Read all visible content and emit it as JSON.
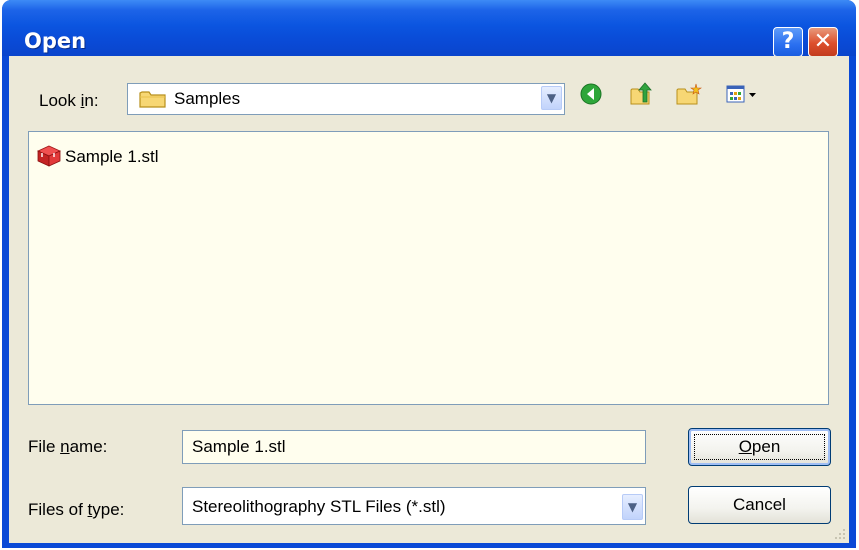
{
  "window": {
    "title": "Open"
  },
  "titlebar": {
    "help_label": "?",
    "close_label": "✕"
  },
  "look_in": {
    "label_pre": "Look ",
    "label_accel": "i",
    "label_post": "n:",
    "value": "Samples"
  },
  "toolbar": {
    "icons": [
      "back-icon",
      "up-folder-icon",
      "new-folder-icon",
      "view-menu-icon"
    ]
  },
  "files": [
    {
      "name": "Sample 1.stl",
      "icon": "stl-file-icon"
    }
  ],
  "file_name": {
    "label_pre": "File ",
    "label_accel": "n",
    "label_post": "ame:",
    "value": "Sample 1.stl"
  },
  "file_type": {
    "label_pre": "Files of ",
    "label_accel": "t",
    "label_post": "ype:",
    "value": "Stereolithography STL Files (*.stl)"
  },
  "buttons": {
    "open_accel": "O",
    "open_rest": "pen",
    "cancel_label": "Cancel"
  },
  "colors": {
    "titlebar": "#0a4ad6",
    "client": "#ece9d8",
    "list_bg": "#fffeee",
    "close": "#dd4f2c"
  }
}
